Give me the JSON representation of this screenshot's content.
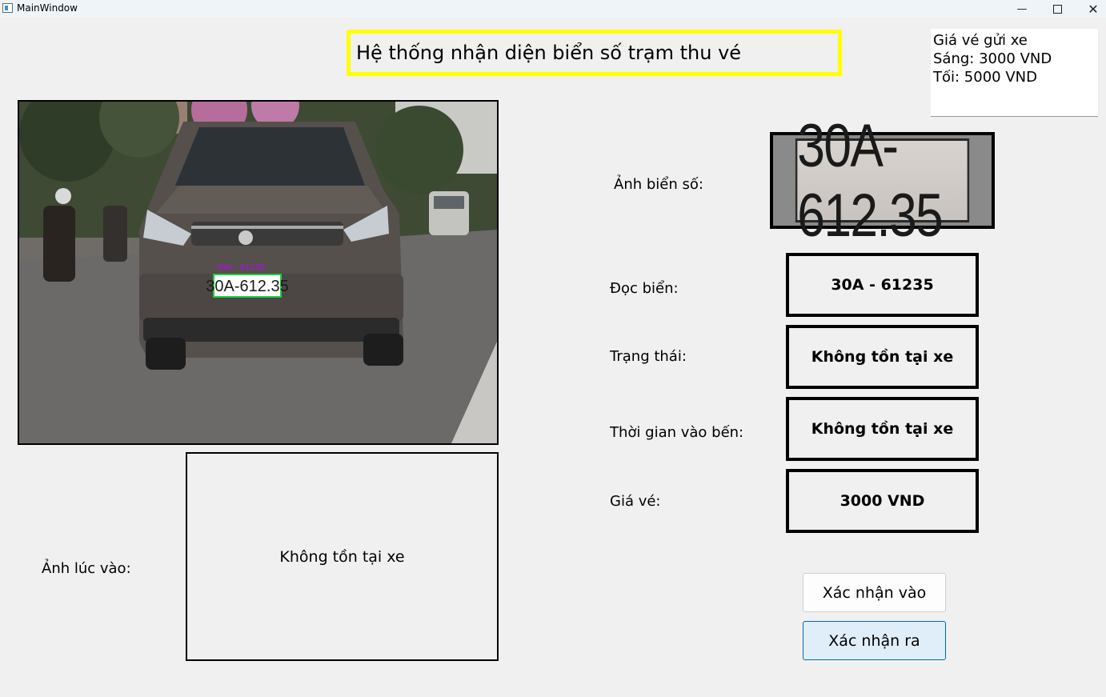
{
  "window": {
    "title": "MainWindow",
    "minimize_icon": "minimize-icon",
    "maximize_icon": "maximize-icon",
    "close_icon": "close-icon"
  },
  "header": {
    "title": "Hệ thống nhận diện biển số trạm thu vé"
  },
  "price_info": {
    "line1": "Giá vé gửi xe",
    "line2": "Sáng: 3000 VND",
    "line3": "Tối: 5000 VND"
  },
  "camera": {
    "plate_text": "30A-612.35",
    "overlay_text": "30A - 61235"
  },
  "plate_crop": {
    "label": "Ảnh biển số:",
    "plate_text": "30A-612.35"
  },
  "read_plate": {
    "label": "Đọc biển:",
    "value": "30A - 61235"
  },
  "status": {
    "label": "Trạng thái:",
    "value": "Không tồn tại xe"
  },
  "entry_time": {
    "label": "Thời gian vào bến:",
    "value": "Không tồn tại xe"
  },
  "price": {
    "label": "Giá vé:",
    "value": "3000 VND"
  },
  "entry_image": {
    "label": "Ảnh lúc vào:",
    "placeholder": "Không tồn tại xe"
  },
  "buttons": {
    "confirm_in": "Xác nhận vào",
    "confirm_out": "Xác nhận ra"
  }
}
